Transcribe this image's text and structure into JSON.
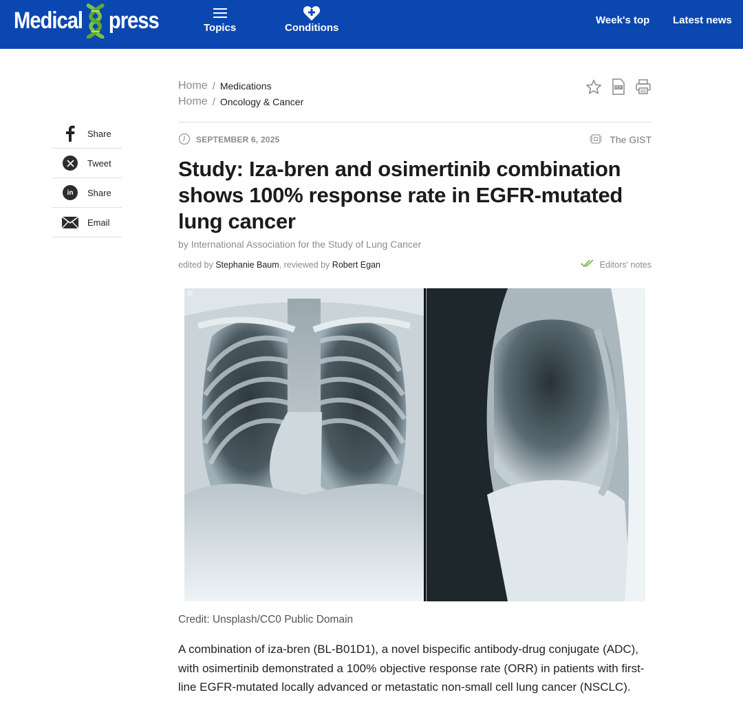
{
  "header": {
    "logo_left": "Medical",
    "logo_right": "press",
    "nav": [
      {
        "label": "Topics",
        "icon": "hamburger-menu-icon"
      },
      {
        "label": "Conditions",
        "icon": "heart-plus-icon"
      }
    ],
    "links": [
      "Week's top",
      "Latest news"
    ],
    "colors": {
      "bar": "#0a47b0",
      "logo_x": "#7cc242"
    }
  },
  "share": [
    {
      "label": "Share",
      "icon": "facebook-icon"
    },
    {
      "label": "Tweet",
      "icon": "x-twitter-icon"
    },
    {
      "label": "Share",
      "icon": "linkedin-icon"
    },
    {
      "label": "Email",
      "icon": "envelope-icon"
    }
  ],
  "breadcrumbs": [
    {
      "home": "Home",
      "sep": "/",
      "category": "Medications"
    },
    {
      "home": "Home",
      "sep": "/",
      "category": "Oncology & Cancer"
    }
  ],
  "tools": [
    "bookmark-star-icon",
    "pdf-icon",
    "print-icon"
  ],
  "article": {
    "date": "SEPTEMBER 6, 2025",
    "gist": "The GIST",
    "title": "Study: Iza-bren and osimertinib combination shows 100% response rate in EGFR-mutated lung cancer",
    "by_prefix": "by",
    "author_org": "International Association for the Study of Lung Cancer",
    "edited_prefix": "edited by",
    "editor": "Stephanie Baum",
    "reviewed_prefix": ", reviewed by",
    "reviewer": "Robert Egan",
    "notes": "Editors' notes",
    "image_marker": "R",
    "credit": "Credit: Unsplash/CC0 Public Domain",
    "lead": "A combination of iza-bren (BL-B01D1), a novel bispecific antibody-drug conjugate (ADC), with osimertinib demonstrated a 100% objective response rate (ORR) in patients with first-line EGFR-mutated locally advanced or metastatic non-small cell lung cancer (NSCLC)."
  }
}
